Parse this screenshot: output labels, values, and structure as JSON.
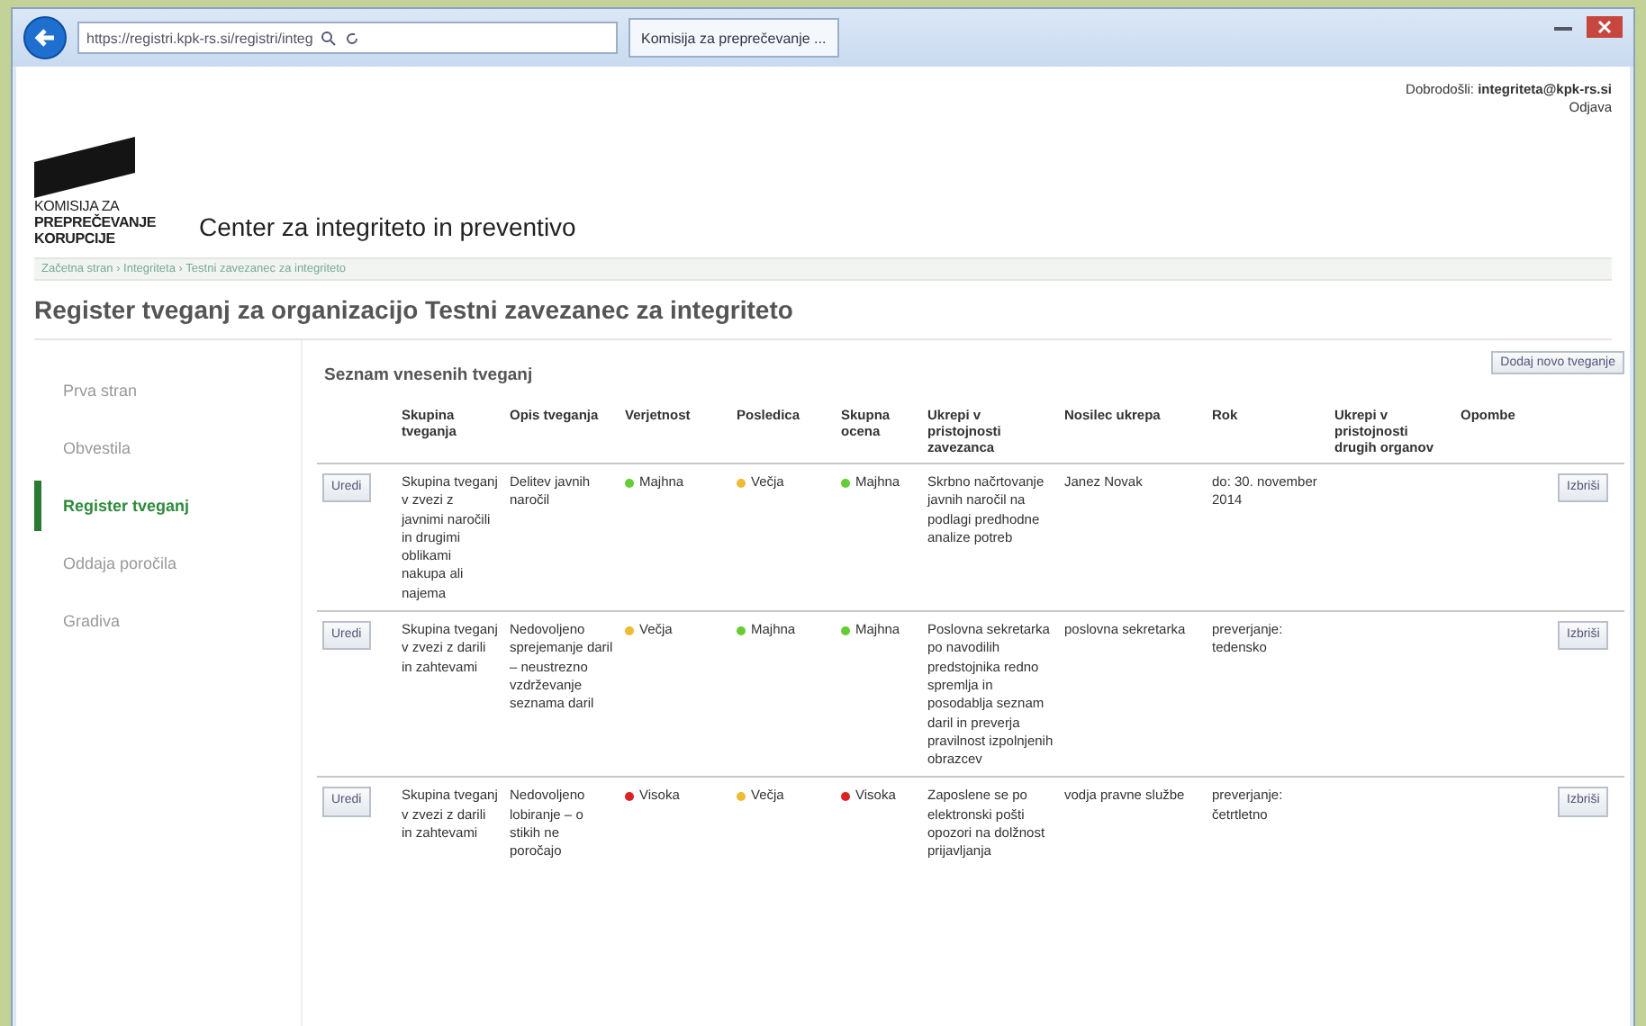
{
  "browser": {
    "address": "https://registri.kpk-rs.si/registri/integ",
    "tab_title": "Komisija za preprečevanje ..."
  },
  "header": {
    "logo_lines": [
      "KOMISIJA ZA",
      "PREPREČEVANJE",
      "KORUPCIJE"
    ],
    "site_title": "Center za integriteto in preventivo",
    "welcome": "Dobrodošli:",
    "user": "integriteta@kpk-rs.si",
    "logout": "Odjava"
  },
  "breadcrumb": {
    "separator": "›",
    "items": [
      "Začetna stran",
      "Integriteta",
      "Testni zavezanec za integriteto"
    ]
  },
  "page_title": "Register tveganj za organizacijo Testni zavezanec za integriteto",
  "sidebar": {
    "items": [
      {
        "label": "Prva stran",
        "selected": false
      },
      {
        "label": "Obvestila",
        "selected": false
      },
      {
        "label": "Register tveganj",
        "selected": true
      },
      {
        "label": "Oddaja poročila",
        "selected": false
      },
      {
        "label": "Gradiva",
        "selected": false
      }
    ]
  },
  "section_title": "Seznam vnesenih tveganj",
  "add_button": "Dodaj novo tveganje",
  "table": {
    "columns": [
      "Skupina tveganja",
      "Opis tveganja",
      "Verjetnost",
      "Posledica",
      "Skupna ocena",
      "Ukrepi v pristojnosti zavezanca",
      "Nosilec ukrepa",
      "Rok",
      "Ukrepi v pristojnosti drugih organov",
      "Opombe"
    ],
    "rows": [
      {
        "edit": "Uredi",
        "delete": "Izbriši",
        "group": "Skupina tveganj v zvezi z javnimi naročili in drugimi oblikami nakupa ali najema",
        "description": "Delitev javnih naročil",
        "likelihood": {
          "text": "Majhna",
          "color": "#66cc33"
        },
        "impact": {
          "text": "Večja",
          "color": "#eebb33"
        },
        "score": {
          "text": "Majhna",
          "color": "#66cc33"
        },
        "measures": "Skrbno načrtovanje javnih naročil na podlagi predhodne analize potreb",
        "owner": "Janez Novak",
        "deadline": "do: 30. november 2014"
      },
      {
        "edit": "Uredi",
        "delete": "Izbriši",
        "group": "Skupina tveganj v zvezi z darili in zahtevami",
        "description": "Nedovoljeno sprejemanje daril – neustrezno vzdrževanje seznama daril",
        "likelihood": {
          "text": "Večja",
          "color": "#eebb33"
        },
        "impact": {
          "text": "Majhna",
          "color": "#66cc33"
        },
        "score": {
          "text": "Majhna",
          "color": "#66cc33"
        },
        "measures": "Poslovna sekretarka po navodilih predstojnika redno spremlja in posodablja seznam daril in preverja pravilnost izpolnjenih obrazcev",
        "owner": "poslovna sekretarka",
        "deadline": "preverjanje: tedensko"
      },
      {
        "edit": "Uredi",
        "delete": "Izbriši",
        "group": "Skupina tveganj v zvezi z darili in zahtevami",
        "description": "Nedovoljeno lobiranje – o stikih ne poročajo",
        "likelihood": {
          "text": "Visoka",
          "color": "#dd2222"
        },
        "impact": {
          "text": "Večja",
          "color": "#eebb33"
        },
        "score": {
          "text": "Visoka",
          "color": "#dd2222"
        },
        "measures": "Zaposlene se po elektronski pošti opozori na dolžnost prijavljanja",
        "owner": "vodja pravne službe",
        "deadline": "preverjanje: četrtletno"
      }
    ]
  }
}
